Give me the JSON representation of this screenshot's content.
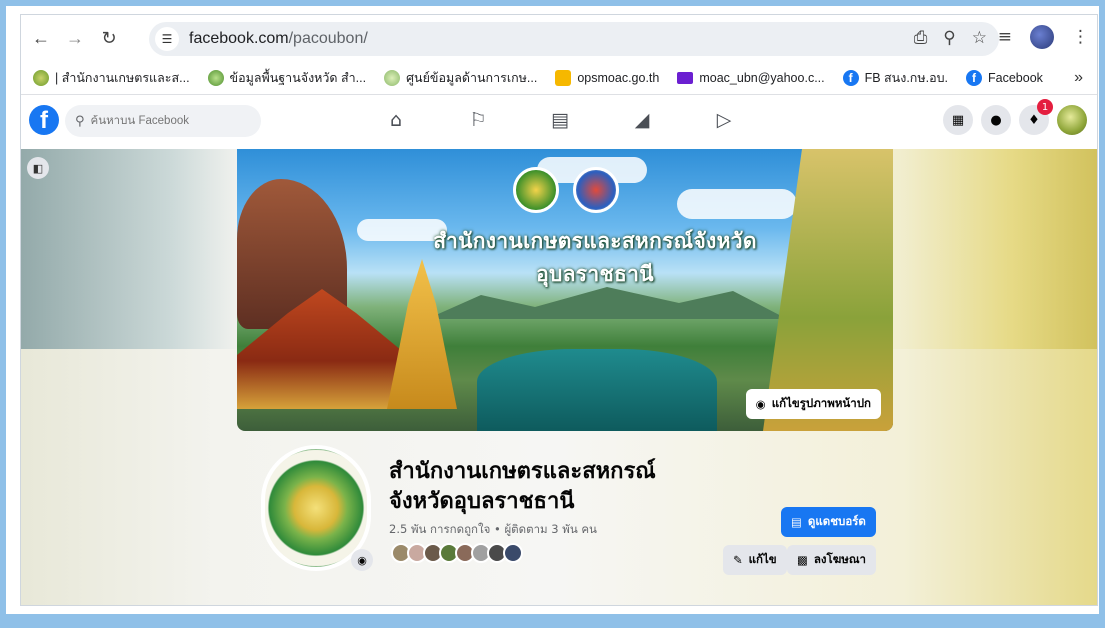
{
  "browser": {
    "url_domain": "facebook.com",
    "url_path": "/pacoubon/",
    "bookmarks": [
      {
        "label": "| สำนักงานเกษตรและส...",
        "icon": "green"
      },
      {
        "label": "ข้อมูลพื้นฐานจังหวัด สำ...",
        "icon": "leaf"
      },
      {
        "label": "ศูนย์ข้อมูลด้านการเกษ...",
        "icon": "flower"
      },
      {
        "label": "opsmoac.go.th",
        "icon": "mail-y"
      },
      {
        "label": "moac_ubn@yahoo.c...",
        "icon": "mail-p"
      },
      {
        "label": "FB สนง.กษ.อบ.",
        "icon": "fb"
      },
      {
        "label": "Facebook",
        "icon": "fb"
      }
    ],
    "more_bookmarks": "»"
  },
  "facebook": {
    "search_placeholder": "ค้นหาบน Facebook",
    "notification_count": "1"
  },
  "cover": {
    "title": "สำนักงานเกษตรและสหกรณ์จังหวัดอุบลราชธานี",
    "edit_label": "แก้ไขรูปภาพหน้าปก"
  },
  "profile": {
    "name_line1": "สำนักงานเกษตรและสหกรณ์",
    "name_line2": "จังหวัดอุบลราชธานี",
    "stats": "2.5 พัน การกดถูกใจ • ผู้ติดตาม 3 พัน คน",
    "dashboard_label": "ดูแดชบอร์ด",
    "edit_label": "แก้ไข",
    "advertise_label": "ลงโฆษณา"
  }
}
